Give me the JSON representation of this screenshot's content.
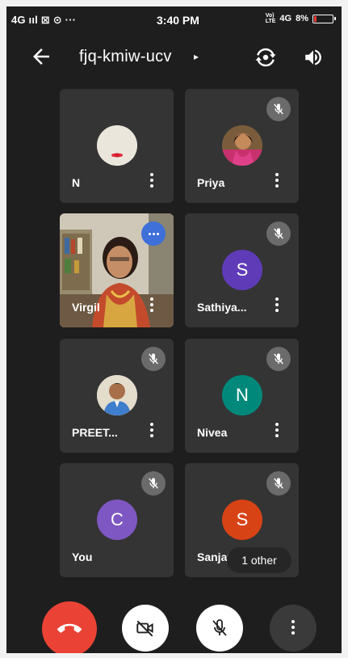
{
  "status_bar": {
    "left": "4G ııl ⊠ ⊙ ···",
    "time": "3:40 PM",
    "volte": "Vo)",
    "lte": "LTE",
    "network": "4G",
    "battery": "8%"
  },
  "header": {
    "meeting_code": "fjq-kmiw-ucv",
    "caret": "▸"
  },
  "participants": [
    {
      "name": "N",
      "avatar": "photo",
      "muted": false
    },
    {
      "name": "Priya",
      "avatar": "photo",
      "muted": true
    },
    {
      "name": "Virgil",
      "avatar": "video",
      "muted": false,
      "speaking": true
    },
    {
      "name": "Sathiya...",
      "initial": "S",
      "color": "#5f3bb8",
      "muted": true
    },
    {
      "name": "PREET...",
      "avatar": "photo",
      "muted": true
    },
    {
      "name": "Nivea",
      "initial": "N",
      "color": "#00897b",
      "muted": true
    },
    {
      "name": "You",
      "initial": "C",
      "color": "#7e57c2",
      "muted": true
    },
    {
      "name": "Sanjay",
      "initial": "S",
      "color": "#d84315",
      "muted": true
    }
  ],
  "overflow": {
    "label": "1 other"
  },
  "colors": {
    "background": "#1e1e1e",
    "tile": "#343434",
    "end_call": "#ea4335",
    "speaking_badge": "#3f6fd8"
  },
  "icons": {
    "back": "back-arrow-icon",
    "switch_camera": "switch-camera-icon",
    "speaker": "speaker-icon",
    "mute": "mic-off-icon",
    "more": "more-vertical-icon",
    "end_call": "end-call-icon",
    "camera_off": "camera-off-icon",
    "mic_off": "mic-off-icon"
  }
}
